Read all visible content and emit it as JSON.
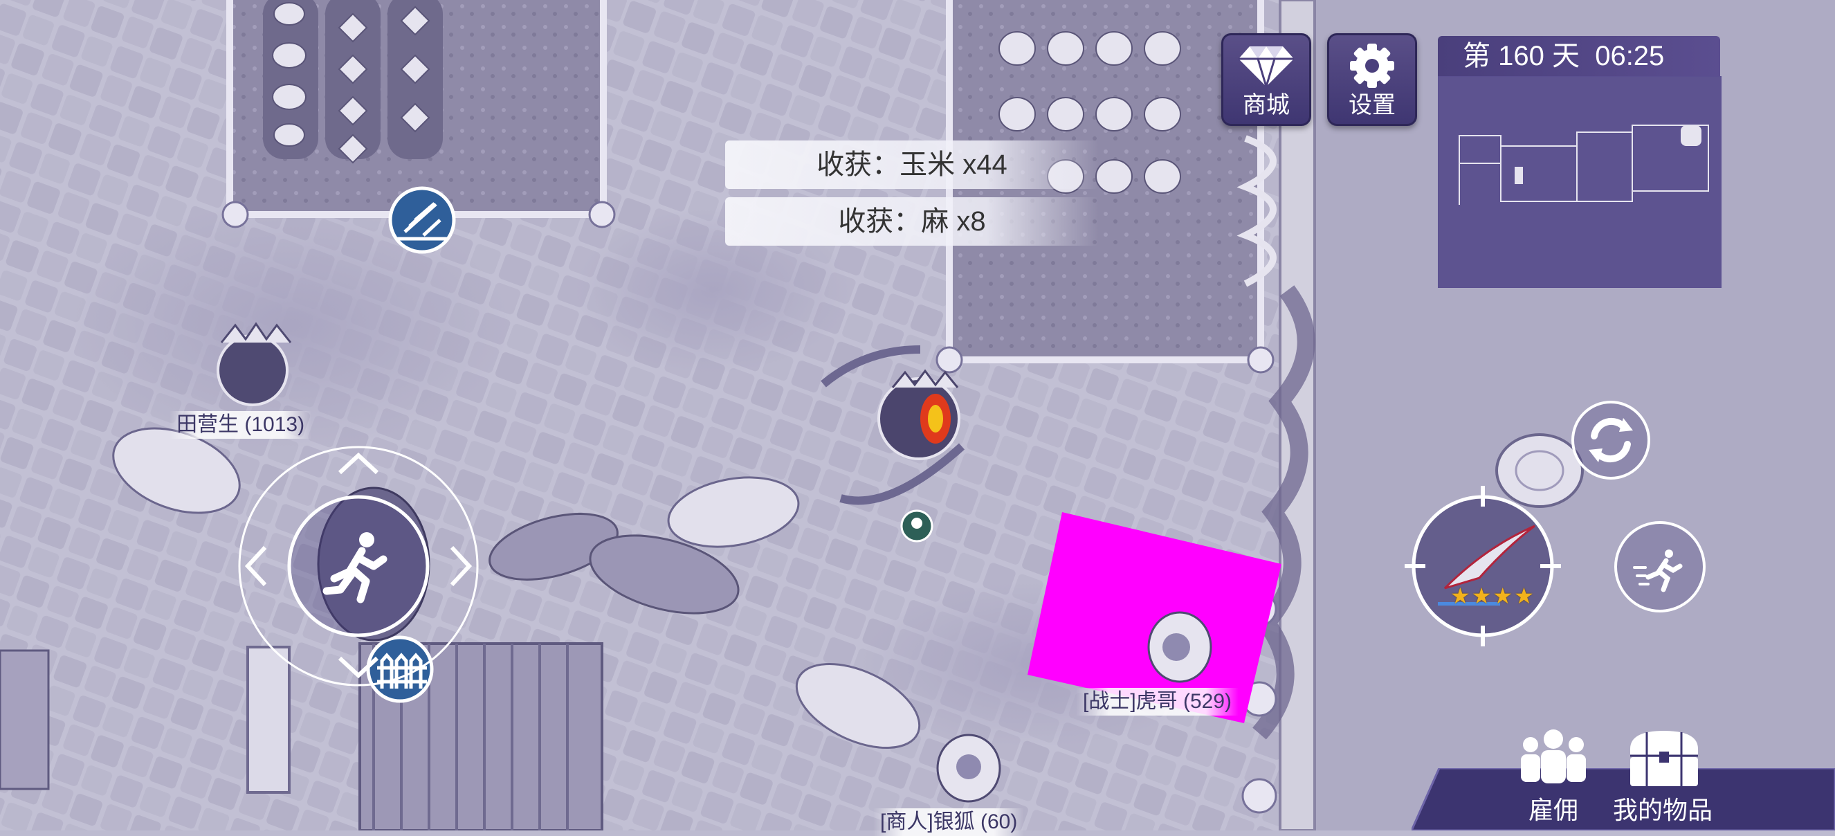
{
  "hud": {
    "shop_label": "商城",
    "settings_label": "设置",
    "day_label": "第 160 天",
    "time": "06:25"
  },
  "notifications": [
    {
      "text": "收获：玉米 x44"
    },
    {
      "text": "收获：麻 x8"
    }
  ],
  "characters": [
    {
      "name": "田营生 (1013)"
    },
    {
      "name": "[战士]虎哥 (529)"
    },
    {
      "name": "[商人]银狐 (60)"
    }
  ],
  "bottom_menu": {
    "hire_label": "雇佣",
    "items_label": "我的物品"
  },
  "weapon": {
    "stars": 4
  },
  "colors": {
    "hud_purple": "#4a3f7c",
    "ground": "#bdbbd0",
    "selection_marker": "#ff00ff",
    "star": "#f2b21c"
  },
  "icons": {
    "shop": "diamond-icon",
    "settings": "gear-icon",
    "joystick": "running-man-icon",
    "swap": "refresh-icon",
    "attack": "crosshair-icon",
    "sprint": "dash-icon",
    "hire": "people-icon",
    "items": "chest-icon",
    "farm": "pitchfork-icon",
    "fence": "fence-icon"
  }
}
